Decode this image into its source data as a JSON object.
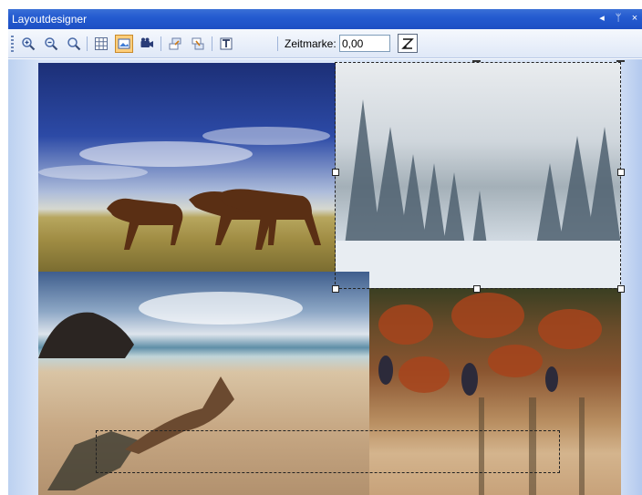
{
  "window": {
    "title": "Layoutdesigner",
    "controls": {
      "arrow": "◂",
      "pin": "ᛘ",
      "close": "×"
    }
  },
  "toolbar": {
    "tools": [
      {
        "name": "zoom-in-icon"
      },
      {
        "name": "zoom-out-icon"
      },
      {
        "name": "zoom-fit-icon"
      },
      {
        "name": "grid-icon"
      },
      {
        "name": "image-layer-icon",
        "active": true
      },
      {
        "name": "camera-icon"
      },
      {
        "name": "bring-forward-icon"
      },
      {
        "name": "send-backward-icon"
      },
      {
        "name": "text-tool-icon"
      }
    ],
    "zeitmarke_label": "Zeitmarke:",
    "zeitmarke_value": "0,00"
  },
  "colors": {
    "titlebar": "#245bd0",
    "canvas_bg": "#dbe6f7",
    "active_tool": "#ffce7a"
  }
}
